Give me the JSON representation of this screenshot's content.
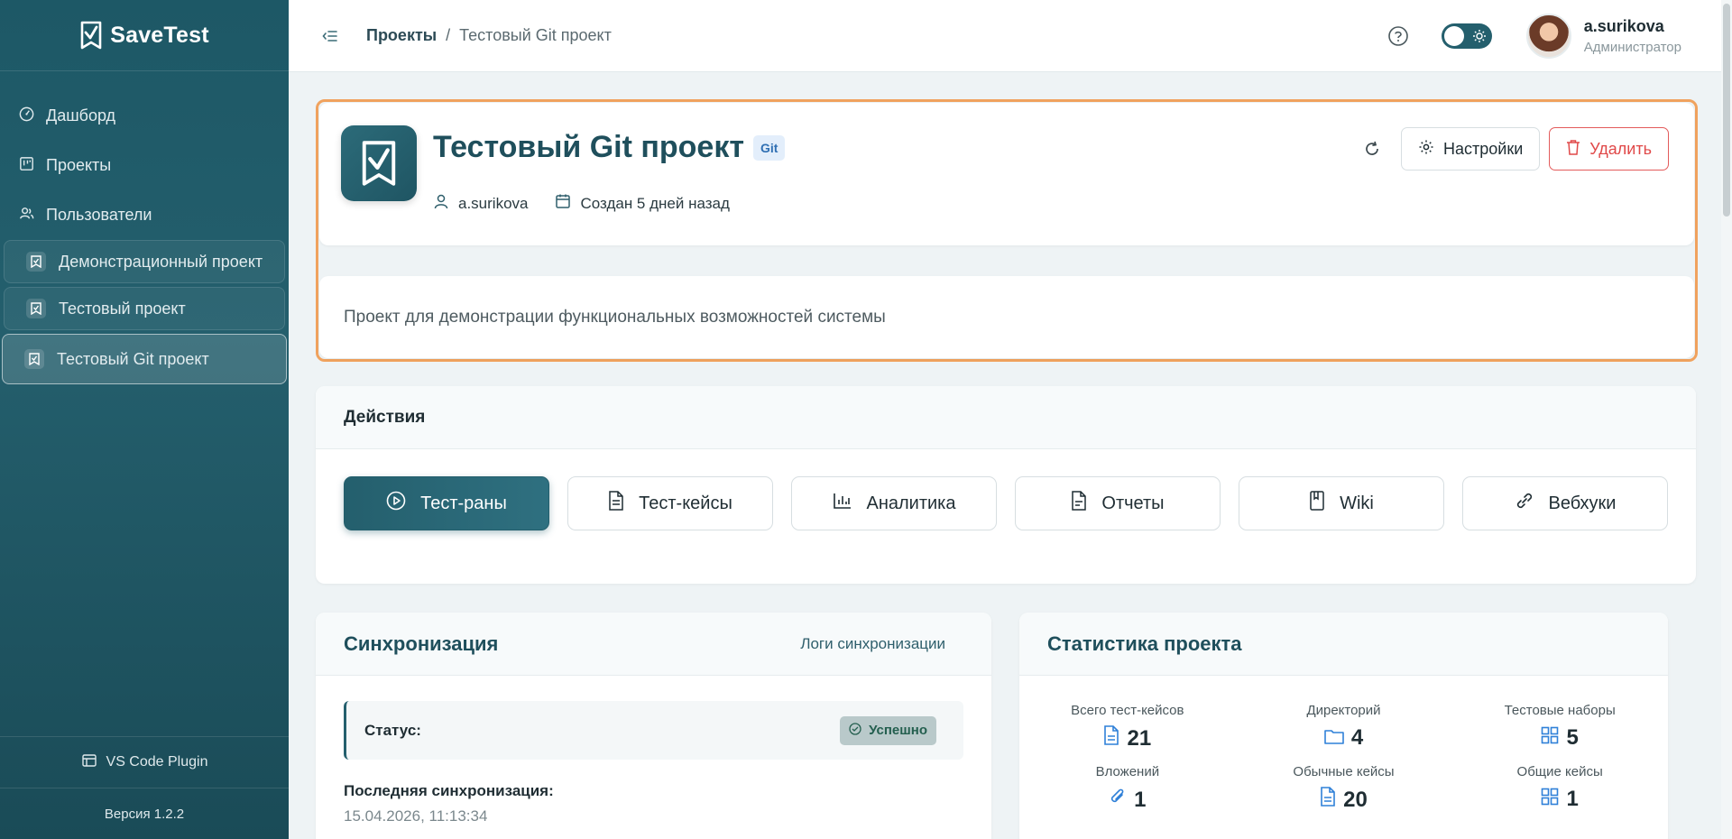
{
  "app": {
    "brand": "SaveTest",
    "version": "Версия 1.2.2",
    "plugin": "VS Code Plugin"
  },
  "sidebar": {
    "nav": [
      {
        "label": "Дашборд",
        "icon": "dashboard-icon"
      },
      {
        "label": "Проекты",
        "icon": "projects-icon"
      },
      {
        "label": "Пользователи",
        "icon": "users-icon"
      }
    ],
    "projects": [
      {
        "label": "Демонстрационный проект"
      },
      {
        "label": "Тестовый проект"
      },
      {
        "label": "Тестовый Git проект",
        "active": true
      }
    ]
  },
  "topbar": {
    "breadcrumb": [
      "Проекты",
      "/",
      "Тестовый Git проект"
    ],
    "user": {
      "name": "a.surikova",
      "role": "Администратор"
    }
  },
  "project": {
    "title": "Тестовый Git проект",
    "badge": "Git",
    "owner": "a.surikova",
    "created": "Создан 5 дней назад",
    "settings_label": "Настройки",
    "delete_label": "Удалить",
    "description": "Проект для демонстрации функциональных возможностей системы"
  },
  "actions": {
    "title": "Действия",
    "tiles": [
      {
        "label": "Тест-раны",
        "icon": "play-icon"
      },
      {
        "label": "Тест-кейсы",
        "icon": "document-icon"
      },
      {
        "label": "Аналитика",
        "icon": "bar-chart-icon"
      },
      {
        "label": "Отчеты",
        "icon": "report-icon"
      },
      {
        "label": "Wiki",
        "icon": "book-icon"
      },
      {
        "label": "Вебхуки",
        "icon": "webhook-icon"
      }
    ]
  },
  "sync": {
    "title": "Синхронизация",
    "logs_link": "Логи синхронизации",
    "status_label": "Статус:",
    "status_value": "Успешно",
    "last_label": "Последняя синхронизация:",
    "last_value": "15.04.2026, 11:13:34"
  },
  "stats": {
    "title": "Статистика проекта",
    "items": [
      {
        "label": "Всего тест-кейсов",
        "value": "21",
        "icon": "file-icon"
      },
      {
        "label": "Директорий",
        "value": "4",
        "icon": "folder-icon"
      },
      {
        "label": "Тестовые наборы",
        "value": "5",
        "icon": "grid-icon"
      },
      {
        "label": "Вложений",
        "value": "1",
        "icon": "paperclip-icon"
      },
      {
        "label": "Обычные кейсы",
        "value": "20",
        "icon": "file-icon"
      },
      {
        "label": "Общие кейсы",
        "value": "1",
        "icon": "grid-icon"
      }
    ]
  },
  "colors": {
    "primary": "#245f6d",
    "accent_blue": "#2f80d8",
    "danger": "#e04848",
    "highlight": "#f0a25e"
  }
}
